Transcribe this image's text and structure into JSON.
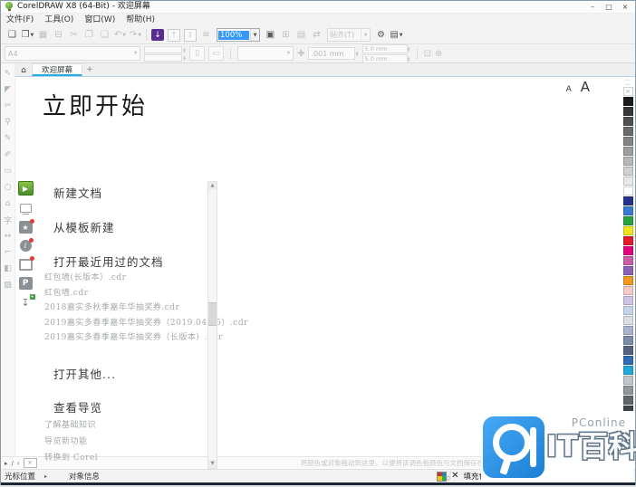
{
  "window": {
    "title": "CorelDRAW X8 (64-Bit) - 欢迎屏幕",
    "minimize_glyph": "–",
    "maximize_glyph": "□",
    "close_glyph": "×"
  },
  "menubar": {
    "items": [
      "文件(F)",
      "工具(O)",
      "窗口(W)",
      "帮助(H)"
    ]
  },
  "standard_toolbar": {
    "zoom_value": "100%",
    "snap_label": "贴齐(T)",
    "items": [
      {
        "name": "new-document-button",
        "kind": "icon",
        "glyph": "❑",
        "enabled": true
      },
      {
        "name": "open-button",
        "kind": "icon-drop",
        "glyph": "❒",
        "enabled": true
      },
      {
        "name": "save-button",
        "kind": "icon",
        "glyph": "▦",
        "enabled": false
      },
      {
        "name": "print-button",
        "kind": "icon",
        "glyph": "⊟",
        "enabled": false
      },
      {
        "name": "cut-button",
        "kind": "icon",
        "glyph": "✂",
        "enabled": false
      },
      {
        "name": "copy-button",
        "kind": "icon",
        "glyph": "❐",
        "enabled": false
      },
      {
        "name": "paste-button",
        "kind": "icon",
        "glyph": "❏",
        "enabled": false
      },
      {
        "name": "undo-button",
        "kind": "icon-drop",
        "glyph": "↶",
        "enabled": false
      },
      {
        "name": "redo-button",
        "kind": "icon-drop",
        "glyph": "↷",
        "enabled": false
      },
      {
        "kind": "sep"
      },
      {
        "name": "import-button",
        "kind": "import",
        "glyph": "↓",
        "enabled": true
      },
      {
        "name": "export-button",
        "kind": "boxed",
        "glyph": "↑",
        "enabled": false
      },
      {
        "name": "publish-pdf-button",
        "kind": "boxed",
        "glyph": "⇧",
        "enabled": false
      },
      {
        "name": "app-launcher-button",
        "kind": "icon",
        "glyph": "≡",
        "enabled": false
      },
      {
        "name": "zoom-level-combo",
        "kind": "zoom"
      },
      {
        "name": "fullscreen-preview-button",
        "kind": "icon",
        "glyph": "▣",
        "enabled": true
      },
      {
        "name": "show-rulers-button",
        "kind": "icon",
        "glyph": "⊞",
        "enabled": false
      },
      {
        "name": "show-grid-button",
        "kind": "icon",
        "glyph": "▤",
        "enabled": false
      },
      {
        "name": "show-guidelines-button",
        "kind": "icon",
        "glyph": "⇄",
        "enabled": false
      },
      {
        "name": "snap-to-combo",
        "kind": "snap"
      },
      {
        "name": "options-button",
        "kind": "icon",
        "glyph": "⚙",
        "enabled": true
      },
      {
        "name": "quick-customize-button",
        "kind": "icon-drop",
        "glyph": "▤",
        "enabled": true
      }
    ]
  },
  "property_bar": {
    "paper_size": "A4",
    "nudge_value": ".001 mm",
    "duplicate_x": "5.0 mm",
    "duplicate_y": "5.0 mm"
  },
  "tabbar": {
    "home_icon": "⌂",
    "active_tab": "欢迎屏幕",
    "new_tab_label": "+"
  },
  "toolbox": {
    "tools": [
      {
        "name": "pick-tool",
        "glyph": "⇖"
      },
      {
        "name": "shape-tool",
        "glyph": "◤"
      },
      {
        "name": "crop-tool",
        "glyph": "✂"
      },
      {
        "name": "zoom-tool",
        "glyph": "⚲"
      },
      {
        "name": "freehand-tool",
        "glyph": "✎"
      },
      {
        "name": "artistic-media-tool",
        "glyph": "✐"
      },
      {
        "name": "rectangle-tool",
        "glyph": "▭"
      },
      {
        "name": "ellipse-tool",
        "glyph": "○"
      },
      {
        "name": "polygon-tool",
        "glyph": "⌂"
      },
      {
        "name": "text-tool",
        "glyph": "字"
      },
      {
        "name": "dimension-tool",
        "glyph": "↔"
      },
      {
        "name": "connector-tool",
        "glyph": "⌐"
      },
      {
        "name": "interactive-fill-tool",
        "glyph": "◧"
      },
      {
        "name": "smart-fill-tool",
        "glyph": "▨"
      }
    ]
  },
  "welcome_strip": {
    "items": [
      {
        "name": "get-started-tab",
        "kind": "play",
        "glyph": "▶",
        "badge": false
      },
      {
        "name": "workspace-tab",
        "kind": "monitor",
        "badge": false
      },
      {
        "name": "whats-new-tab",
        "kind": "star",
        "glyph": "★",
        "badge": true
      },
      {
        "name": "need-help-tab",
        "kind": "info",
        "glyph": "i",
        "badge": true
      },
      {
        "name": "gallery-tab",
        "kind": "frame",
        "badge": true
      },
      {
        "name": "product-details-tab",
        "kind": "pbox",
        "glyph": "P",
        "badge": false
      },
      {
        "name": "updates-tab",
        "kind": "update",
        "glyph": "↧",
        "badge": false,
        "plus": true
      }
    ]
  },
  "welcome": {
    "title": "立即开始",
    "font_small_label": "A",
    "font_large_label": "A",
    "link_new": "新建文档",
    "link_template": "从模板新建",
    "recent_header": "打开最近用过的文档",
    "recent_files": [
      "红包墙(长版本）.cdr",
      "红包墙.cdr",
      "2018嘉实多秋季嘉年华抽奖券.cdr",
      "2019嘉实多春季嘉年华抽奖券（2019.04.15）.cdr",
      "2019嘉实多春季嘉年华抽奖券（长版本）.cdr"
    ],
    "link_open_other": "打开其他...",
    "tours_header": "查看导览",
    "tour_links": [
      "了解基础知识",
      "导览新功能",
      "转换到 Corel"
    ]
  },
  "palette": {
    "colors": [
      "#1b1b1b",
      "#373737",
      "#515151",
      "#6b6b6b",
      "#858585",
      "#9e9e9e",
      "#b7b7b7",
      "#d0d0d0",
      "#e9e9e9",
      "#ffffff",
      "#27318e",
      "#3a7bd0",
      "#27a23c",
      "#f2e51f",
      "#e41b2d",
      "#e2057f",
      "#cb5fa5",
      "#8a63b7",
      "#f0981f",
      "#f6caca",
      "#cdc5e2",
      "#c7d5ea",
      "#dddfe7",
      "#a9b3cb",
      "#7d8aa9",
      "#56627f",
      "#2f6cb5",
      "#20a8dc",
      "#c2c6ca",
      "#90969a",
      "#62676a",
      "#3e4548",
      "#42806f",
      "#6f9287"
    ]
  },
  "doc_palette": {
    "hint": "将颜色或对象拖动到这里，以便将该调色板颜色与文档保存在一起"
  },
  "statusbar": {
    "cursor_label": "光标位置",
    "object_label": "对象信息",
    "fill_label": "填充色"
  },
  "watermark": {
    "brand": "PConline",
    "title": "IT百科"
  }
}
